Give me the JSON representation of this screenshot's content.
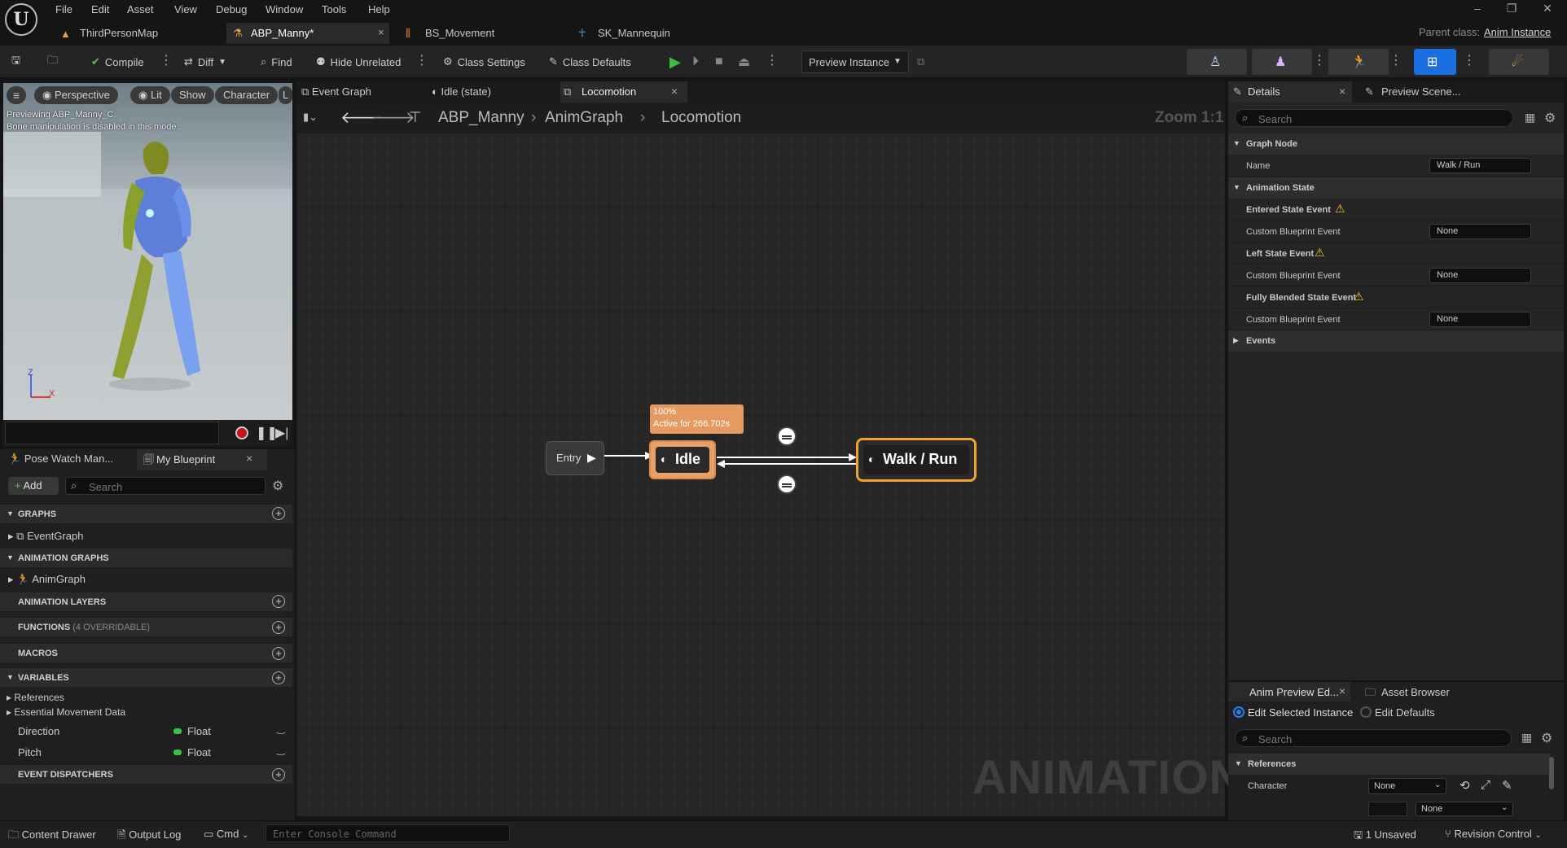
{
  "menu": [
    "File",
    "Edit",
    "Asset",
    "View",
    "Debug",
    "Window",
    "Tools",
    "Help"
  ],
  "doc_tabs": [
    "ThirdPersonMap",
    "ABP_Manny*",
    "BS_Movement",
    "SK_Mannequin"
  ],
  "parent_class": {
    "label": "Parent class:",
    "value": "Anim Instance"
  },
  "toolbar": {
    "compile": "Compile",
    "diff": "Diff",
    "find": "Find",
    "hide_unrelated": "Hide Unrelated",
    "class_settings": "Class Settings",
    "class_defaults": "Class Defaults",
    "preview_instance": "Preview Instance"
  },
  "viewport": {
    "perspective": "Perspective",
    "lit": "Lit",
    "show": "Show",
    "character": "Character",
    "cut_pill": "L",
    "preview_line1": "Previewing ABP_Manny_C.",
    "preview_line2": "Bone manipulation is disabled in this mode.",
    "axis_z": "Z",
    "axis_x": "X"
  },
  "left_tabs": {
    "pose_watch": "Pose Watch Man...",
    "my_blueprint": "My Blueprint"
  },
  "my_blueprint": {
    "add": "Add",
    "search_placeholder": "Search",
    "graphs": "GRAPHS",
    "event_graph": "EventGraph",
    "animation_graphs": "ANIMATION GRAPHS",
    "anim_graph": "AnimGraph",
    "animation_layers": "ANIMATION LAYERS",
    "functions": "FUNCTIONS",
    "functions_note": "(4 OVERRIDABLE)",
    "macros": "MACROS",
    "variables": "VARIABLES",
    "references": "References",
    "essential": "Essential Movement Data",
    "vars": [
      {
        "name": "Direction",
        "type": "Float"
      },
      {
        "name": "Pitch",
        "type": "Float"
      }
    ],
    "event_dispatchers": "EVENT DISPATCHERS"
  },
  "graph_tabs": [
    "Event Graph",
    "Idle (state)",
    "Locomotion"
  ],
  "breadcrumb": [
    "ABP_Manny",
    "AnimGraph",
    "Locomotion"
  ],
  "zoom": "Zoom 1:1",
  "watermark": "ANIMATION",
  "nodes": {
    "entry": "Entry",
    "idle": "Idle",
    "walk_run": "Walk / Run",
    "debug_line1": "100%",
    "debug_line2": "Active for 266.702s"
  },
  "details_tabs": [
    "Details",
    "Preview Scene..."
  ],
  "details": {
    "search_placeholder": "Search",
    "graph_node": "Graph Node",
    "name_label": "Name",
    "name_value": "Walk / Run",
    "animation_state": "Animation State",
    "entered": "Entered State Event",
    "left": "Left State Event",
    "fully_blended": "Fully Blended State Event",
    "custom_event": "Custom Blueprint Event",
    "none": "None",
    "events": "Events"
  },
  "preview_panel": {
    "tab1": "Anim Preview Ed...",
    "tab2": "Asset Browser",
    "edit_selected": "Edit Selected Instance",
    "edit_defaults": "Edit Defaults",
    "search_placeholder": "Search",
    "references": "References",
    "character": "Character",
    "none": "None"
  },
  "statusbar": {
    "content_drawer": "Content Drawer",
    "output_log": "Output Log",
    "cmd": "Cmd",
    "console_placeholder": "Enter Console Command",
    "unsaved": "1 Unsaved",
    "revision": "Revision Control"
  },
  "colors": {
    "accent_orange": "#f0a030",
    "play_green": "#3fbf3f",
    "float_green": "#40c040",
    "active_blue": "#1a6fe0"
  }
}
